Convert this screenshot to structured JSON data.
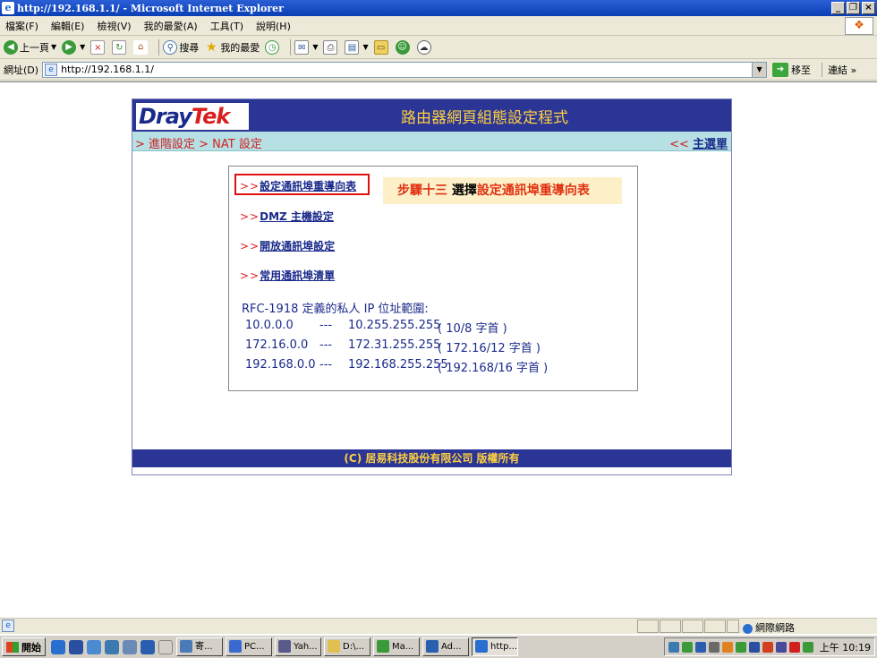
{
  "window": {
    "title": "http://192.168.1.1/ - Microsoft Internet Explorer",
    "btn_min": "_",
    "btn_max": "❐",
    "btn_close": "×"
  },
  "menu": [
    {
      "label": "檔案(F)"
    },
    {
      "label": "編輯(E)"
    },
    {
      "label": "檢視(V)"
    },
    {
      "label": "我的最愛(A)"
    },
    {
      "label": "工具(T)"
    },
    {
      "label": "說明(H)"
    }
  ],
  "toolbar": {
    "back": "上一頁",
    "search": "搜尋",
    "favorites": "我的最愛"
  },
  "address": {
    "label": "網址(D)",
    "url": "http://192.168.1.1/",
    "go": "移至",
    "links": "連結 »"
  },
  "page": {
    "logo_dray": "Dray",
    "logo_tek": "Tek",
    "header_title": "路由器網頁組態設定程式",
    "breadcrumb": "> 進階設定 > NAT 設定",
    "main_menu_prefix": "<< ",
    "main_menu": "主選單",
    "links": [
      {
        "arrow": ">>",
        "label": "設定通訊埠重導向表"
      },
      {
        "arrow": ">>",
        "label": "DMZ 主機設定"
      },
      {
        "arrow": ">>",
        "label": "開放通訊埠設定"
      },
      {
        "arrow": ">>",
        "label": "常用通訊埠清單"
      }
    ],
    "step": {
      "part1": "步驟十三",
      "part2": "選擇",
      "part3": "設定通訊埠重導向表"
    },
    "rfc_title": "RFC-1918 定義的私人 IP 位址範圍:",
    "rfc_rows": [
      {
        "start": "10.0.0.0",
        "sep": "---",
        "end": "10.255.255.255",
        "prefix": "( 10/8 字首 )"
      },
      {
        "start": "172.16.0.0",
        "sep": "---",
        "end": "172.31.255.255",
        "prefix": "( 172.16/12 字首 )"
      },
      {
        "start": "192.168.0.0",
        "sep": "---",
        "end": "192.168.255.255",
        "prefix": "( 192.168/16 字首 )"
      }
    ],
    "footer": "(C) 居易科技股份有限公司 版權所有"
  },
  "status": {
    "zone": "網際網路"
  },
  "taskbar": {
    "start": "開始",
    "tasks": [
      {
        "label": "寄..."
      },
      {
        "label": "PC..."
      },
      {
        "label": "Yah..."
      },
      {
        "label": "D:\\..."
      },
      {
        "label": "Ma..."
      },
      {
        "label": "Ad..."
      },
      {
        "label": "http..."
      }
    ],
    "clock": "上午 10:19"
  },
  "colors": {
    "header_bg": "#2a3596",
    "header_text": "#ffd040",
    "breadcrumb_bg": "#b7e0e4",
    "highlight_red": "#e01010",
    "step_bg": "#fdf0c8"
  }
}
